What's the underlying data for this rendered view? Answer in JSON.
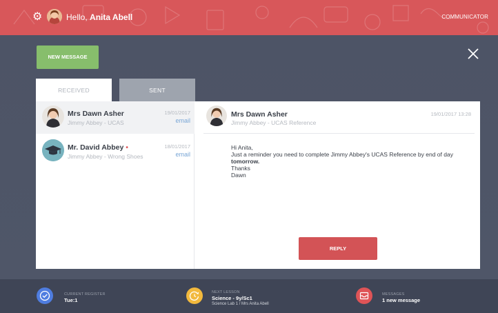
{
  "header": {
    "greeting_prefix": "Hello,",
    "user_name": "Anita Abell",
    "app_label": "COMMUNICATOR",
    "bar_color": "#d8575a"
  },
  "toolbar": {
    "new_message_label": "NEW MESSAGE"
  },
  "tabs": {
    "received_label": "RECEIVED",
    "sent_label": "SENT",
    "active": "RECEIVED"
  },
  "messages": [
    {
      "name": "Mrs Dawn Asher",
      "subject": "Jimmy Abbey - UCAS",
      "date": "19/01/2017",
      "type": "email",
      "unread": false,
      "selected": true
    },
    {
      "name": "Mr. David Abbey",
      "subject": "Jimmy Abbey - Wrong Shoes",
      "date": "18/01/2017",
      "type": "email",
      "unread": true,
      "selected": false
    }
  ],
  "detail": {
    "name": "Mrs Dawn Asher",
    "subject": "Jimmy Abbey - UCAS Reference",
    "datetime": "19/01/2017 13:28",
    "greeting": "Hi Anita,",
    "body_line1": "Just a reminder you need to complete Jimmy Abbey's UCAS Reference by end of day ",
    "body_emph": "tomorrow.",
    "closing": "Thanks",
    "signature": "Dawn",
    "reply_label": "REPLY"
  },
  "footer": {
    "register_label": "CURRENT REGISTER",
    "register_value": "Tue:1",
    "lesson_label": "NEXT LESSON",
    "lesson_value": "Science - 9y/Sc1",
    "lesson_detail": "Science Lab 1 / Mrs Anita Abell",
    "messages_label": "MESSAGES",
    "messages_value": "1 new message",
    "colors": {
      "register": "#4f7de0",
      "lesson": "#f2b93d",
      "messages": "#df5457"
    }
  }
}
